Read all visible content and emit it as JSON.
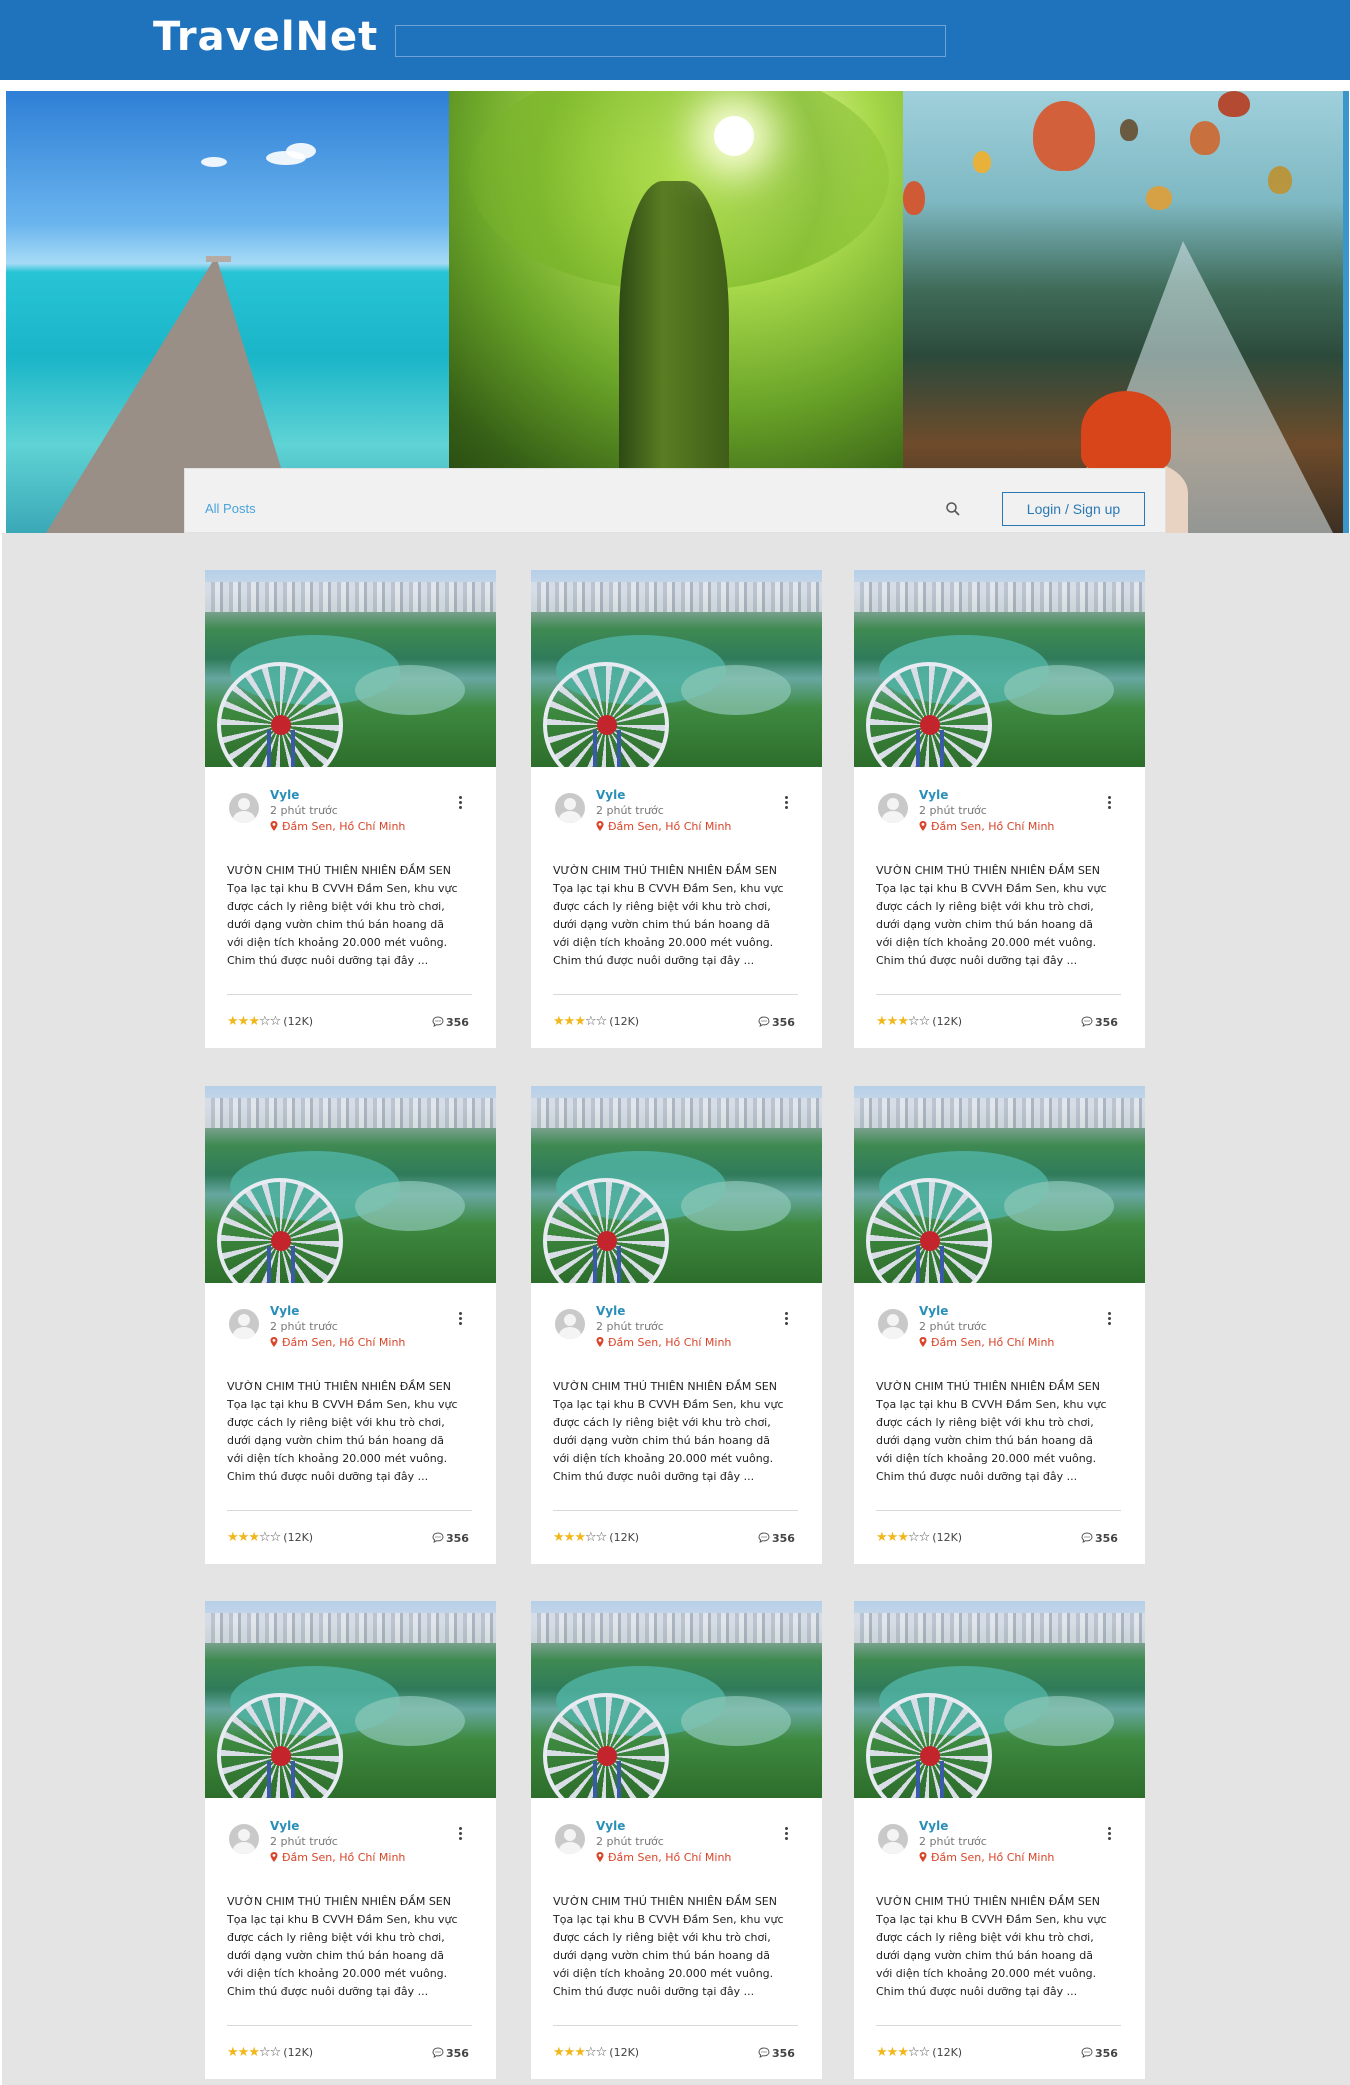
{
  "header": {
    "logo": "TravelNet",
    "search_value": "",
    "colors": {
      "bar": "#1f73bd"
    }
  },
  "hero": {
    "panels": [
      "pier-ocean",
      "tree-forest",
      "balloons-bridge"
    ]
  },
  "subnav": {
    "all_posts": "All Posts",
    "search_icon": "search-icon",
    "login_label": "Login / Sign up"
  },
  "posts": [
    {
      "author": "Vyle",
      "time": "2 phút trước",
      "location": "Đầm Sen, Hồ Chí Minh",
      "title": "VƯỜN CHIM THÚ THIÊN NHIÊN ĐẦM SEN",
      "lines": [
        "Tọa lạc tại khu B CVVH Đầm Sen, khu vực",
        "được cách ly riêng biệt với khu trò chơi,",
        "dưới dạng vườn chim thú bán hoang dã",
        "với diện tích khoảng 20.000 mét vuông.",
        "Chim thú được nuôi dưỡng tại đây ..."
      ],
      "rating": 3,
      "rating_max": 5,
      "rating_count": "(12K)",
      "comments": "356"
    }
  ],
  "grid": {
    "rows": 3,
    "cols": 3
  }
}
